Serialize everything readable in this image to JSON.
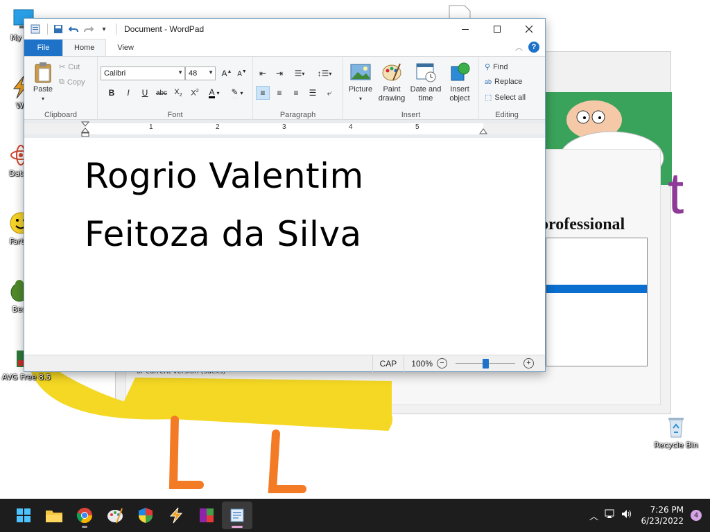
{
  "desktop": {
    "icons": [
      {
        "label": "My Co"
      },
      {
        "label": "Wi"
      },
      {
        "label": "DataV"
      },
      {
        "label": "Fart D"
      },
      {
        "label": "Bea"
      },
      {
        "label": "AVG Free 8.5"
      },
      {
        "label": "Recycle Bin"
      }
    ],
    "background_window": {
      "heading": "orofessional",
      "big_letter": "t",
      "caption": "or current version (sucks)"
    }
  },
  "wordpad": {
    "title": "Document - WordPad",
    "tabs": {
      "file": "File",
      "home": "Home",
      "view": "View"
    },
    "clipboard": {
      "paste": "Paste",
      "cut": "Cut",
      "copy": "Copy",
      "group": "Clipboard"
    },
    "font": {
      "family": "Calibri",
      "size": "48",
      "group": "Font"
    },
    "paragraph": {
      "group": "Paragraph"
    },
    "insert": {
      "picture": "Picture",
      "paint1": "Paint",
      "paint2": "drawing",
      "dt1": "Date and",
      "dt2": "time",
      "obj1": "Insert",
      "obj2": "object",
      "group": "Insert"
    },
    "editing": {
      "find": "Find",
      "replace": "Replace",
      "select_all": "Select all",
      "group": "Editing"
    },
    "ruler": {
      "numbers": [
        "1",
        "2",
        "3",
        "4",
        "5"
      ]
    },
    "document": {
      "line1": "Rogrio Valentim",
      "line2": "Feitoza da Silva"
    },
    "status": {
      "caps": "CAP",
      "zoom": "100%",
      "zoom_level_pct": 50
    }
  },
  "taskbar": {
    "time": "7:26 PM",
    "date": "6/23/2022",
    "notifications": "4",
    "apps": [
      "start",
      "file-explorer",
      "chrome",
      "paint-3d",
      "security-shield",
      "wordpad-pin",
      "winrar",
      "wordpad"
    ]
  },
  "colors": {
    "accent": "#1e73c8",
    "taskbar": "#1d1d1d",
    "doodle_yellow": "#f5d824",
    "doodle_orange": "#f47b26"
  }
}
